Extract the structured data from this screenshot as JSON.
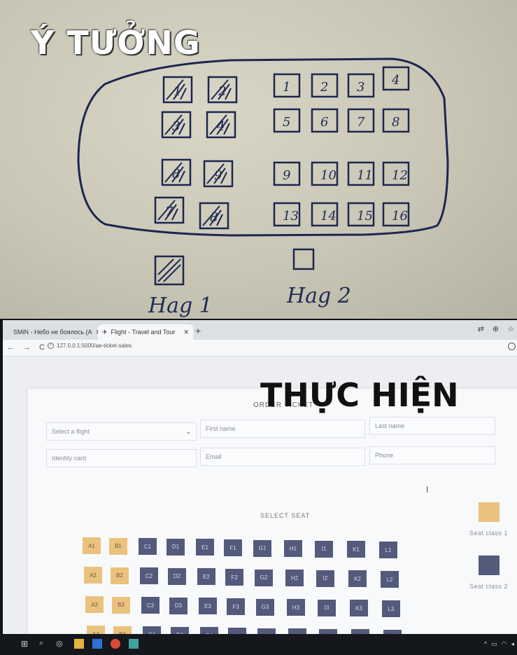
{
  "sketch": {
    "title": "Ý TƯỞNG",
    "left_block": [
      "1",
      "2",
      "3",
      "4",
      "8",
      "9",
      "7",
      "8"
    ],
    "right_block": [
      "1",
      "2",
      "3",
      "4",
      "5",
      "6",
      "7",
      "8",
      "9",
      "10",
      "11",
      "12",
      "13",
      "14",
      "15",
      "16"
    ],
    "legend": [
      {
        "label": "Hag 1"
      },
      {
        "label": "Hag 2"
      }
    ]
  },
  "browser": {
    "tabs": [
      {
        "title": "SMiN - Небо не боялось (А",
        "active": false
      },
      {
        "title": "Flight - Travel and Tour",
        "active": true
      }
    ],
    "url": "127.0.0.1:5000/ae-ticket-sales"
  },
  "form": {
    "title": "ORDER TICKET",
    "flight_select": {
      "placeholder": "Select a flight"
    },
    "first_name": {
      "placeholder": "First name"
    },
    "last_name": {
      "placeholder": "Last name"
    },
    "identity_card": {
      "placeholder": "Identity card"
    },
    "email": {
      "placeholder": "Email"
    },
    "phone": {
      "placeholder": "Phone"
    },
    "select_seat_label": "SELECT SEAT"
  },
  "seats": {
    "columns": [
      "A",
      "B",
      "C",
      "D",
      "E",
      "F",
      "G",
      "H",
      "I",
      "K",
      "L"
    ],
    "rows": [
      "1",
      "2",
      "3",
      "4"
    ],
    "class1_columns": [
      "A",
      "B"
    ],
    "colors": {
      "class1": "#eac27d",
      "class2": "#535a7c"
    }
  },
  "legend": [
    {
      "label": "Seat class 1",
      "color": "#eac27d"
    },
    {
      "label": "Seat class 2",
      "color": "#535a7c"
    }
  ],
  "overlay_title": "THỰC HIỆN"
}
